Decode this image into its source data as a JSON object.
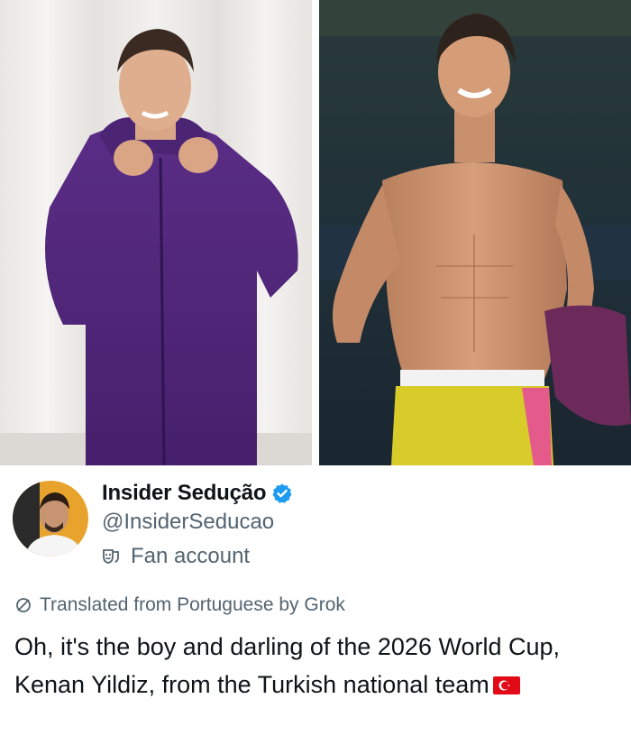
{
  "tweet": {
    "display_name": "Insider Sedução",
    "handle": "@InsiderSeducao",
    "account_label": "Fan account",
    "translated_label": "Translated from Portuguese by Grok",
    "text": "Oh, it's the boy and darling of the 2026 World Cup, Kenan Yildiz, from the Turkish national team",
    "flag_icon": "turkey-flag-icon",
    "verified_icon": "verified-badge-icon",
    "account_icon": "theater-masks-icon",
    "translate_icon": "translate-icon"
  },
  "photos": {
    "left": "photo-purple-hoodie",
    "right": "photo-stadium-shirtless"
  },
  "colors": {
    "text_primary": "#0f1419",
    "text_secondary": "#536471",
    "verified_blue": "#1d9bf0",
    "flag_red": "#e30a17"
  }
}
